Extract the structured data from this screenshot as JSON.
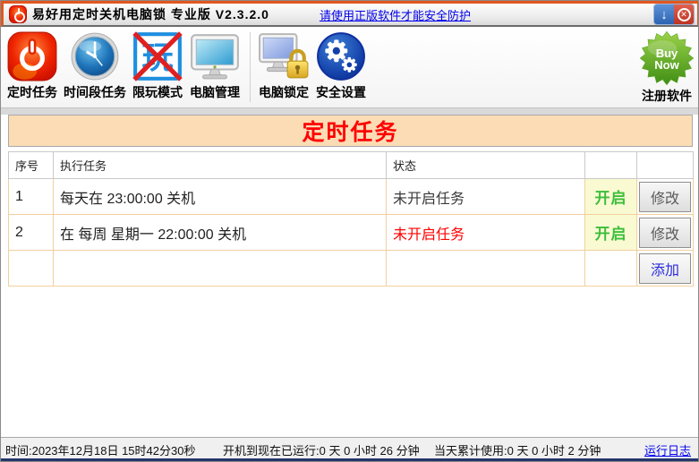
{
  "window": {
    "title": "易好用定时关机电脑锁 专业版 V2.3.2.0",
    "notice_link": "请使用正版软件才能安全防护",
    "minimize_glyph": "↓",
    "close_glyph": "✕"
  },
  "toolbar": {
    "items": [
      {
        "id": "timer-task",
        "label": "定时任务"
      },
      {
        "id": "period-task",
        "label": "时间段任务"
      },
      {
        "id": "limit-play",
        "label": "限玩模式",
        "glyph": "玩"
      },
      {
        "id": "pc-manage",
        "label": "电脑管理"
      },
      {
        "id": "pc-lock",
        "label": "电脑锁定"
      },
      {
        "id": "security-settings",
        "label": "安全设置"
      }
    ],
    "register": {
      "label": "注册软件",
      "badge_top": "Buy",
      "badge_bottom": "Now"
    }
  },
  "section_header": {
    "title": "定时任务"
  },
  "table": {
    "columns": {
      "no": "序号",
      "task": "执行任务",
      "status": "状态"
    },
    "rows": [
      {
        "no": "1",
        "task": "每天在 23:00:00 关机",
        "status": "未开启任务",
        "status_color": "#3a3a3a",
        "enable": "开启",
        "modify": "修改"
      },
      {
        "no": "2",
        "task": "在 每周 星期一 22:00:00 关机",
        "status": "未开启任务",
        "status_color": "#ff0000",
        "enable": "开启",
        "modify": "修改"
      },
      {
        "no": "",
        "task": "",
        "status": "",
        "status_color": "",
        "enable": "",
        "modify": "添加"
      }
    ]
  },
  "statusbar": {
    "time": "时间:2023年12月18日 15时42分30秒",
    "uptime": "开机到现在已运行:0 天 0 小时 26 分钟",
    "usage": "当天累计使用:0 天 0 小时 2 分钟",
    "log_link": "运行日志"
  },
  "colors": {
    "accent_orange": "#e2571e",
    "band_bg": "#fcdcb5",
    "band_text": "#ff0000",
    "enable_green": "#3cbe3c",
    "enable_bg": "#fafad2",
    "link_blue": "#0000ee",
    "alt_row_gray": "#dcdcdc",
    "bottom_strip_navy": "#24356b"
  }
}
